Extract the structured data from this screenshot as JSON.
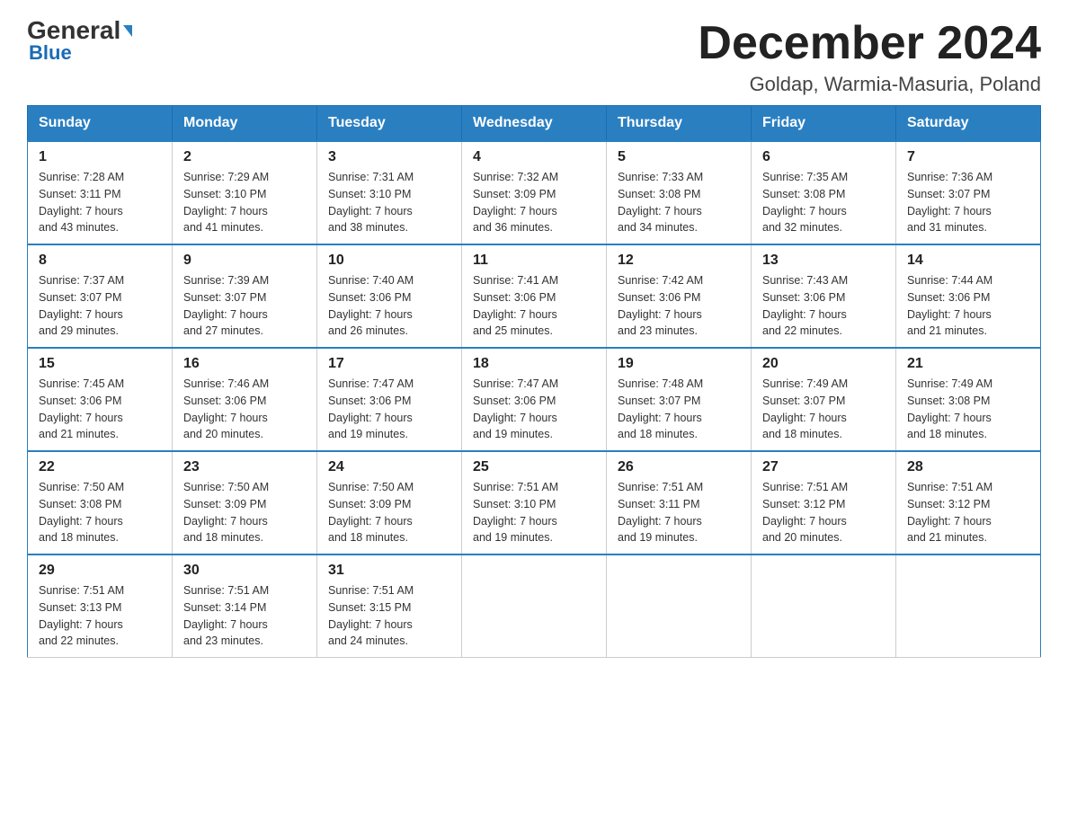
{
  "header": {
    "title": "December 2024",
    "location": "Goldap, Warmia-Masuria, Poland",
    "logo_general": "General",
    "logo_blue": "Blue"
  },
  "columns": [
    "Sunday",
    "Monday",
    "Tuesday",
    "Wednesday",
    "Thursday",
    "Friday",
    "Saturday"
  ],
  "weeks": [
    [
      {
        "day": "1",
        "sunrise": "7:28 AM",
        "sunset": "3:11 PM",
        "daylight": "7 hours and 43 minutes."
      },
      {
        "day": "2",
        "sunrise": "7:29 AM",
        "sunset": "3:10 PM",
        "daylight": "7 hours and 41 minutes."
      },
      {
        "day": "3",
        "sunrise": "7:31 AM",
        "sunset": "3:10 PM",
        "daylight": "7 hours and 38 minutes."
      },
      {
        "day": "4",
        "sunrise": "7:32 AM",
        "sunset": "3:09 PM",
        "daylight": "7 hours and 36 minutes."
      },
      {
        "day": "5",
        "sunrise": "7:33 AM",
        "sunset": "3:08 PM",
        "daylight": "7 hours and 34 minutes."
      },
      {
        "day": "6",
        "sunrise": "7:35 AM",
        "sunset": "3:08 PM",
        "daylight": "7 hours and 32 minutes."
      },
      {
        "day": "7",
        "sunrise": "7:36 AM",
        "sunset": "3:07 PM",
        "daylight": "7 hours and 31 minutes."
      }
    ],
    [
      {
        "day": "8",
        "sunrise": "7:37 AM",
        "sunset": "3:07 PM",
        "daylight": "7 hours and 29 minutes."
      },
      {
        "day": "9",
        "sunrise": "7:39 AM",
        "sunset": "3:07 PM",
        "daylight": "7 hours and 27 minutes."
      },
      {
        "day": "10",
        "sunrise": "7:40 AM",
        "sunset": "3:06 PM",
        "daylight": "7 hours and 26 minutes."
      },
      {
        "day": "11",
        "sunrise": "7:41 AM",
        "sunset": "3:06 PM",
        "daylight": "7 hours and 25 minutes."
      },
      {
        "day": "12",
        "sunrise": "7:42 AM",
        "sunset": "3:06 PM",
        "daylight": "7 hours and 23 minutes."
      },
      {
        "day": "13",
        "sunrise": "7:43 AM",
        "sunset": "3:06 PM",
        "daylight": "7 hours and 22 minutes."
      },
      {
        "day": "14",
        "sunrise": "7:44 AM",
        "sunset": "3:06 PM",
        "daylight": "7 hours and 21 minutes."
      }
    ],
    [
      {
        "day": "15",
        "sunrise": "7:45 AM",
        "sunset": "3:06 PM",
        "daylight": "7 hours and 21 minutes."
      },
      {
        "day": "16",
        "sunrise": "7:46 AM",
        "sunset": "3:06 PM",
        "daylight": "7 hours and 20 minutes."
      },
      {
        "day": "17",
        "sunrise": "7:47 AM",
        "sunset": "3:06 PM",
        "daylight": "7 hours and 19 minutes."
      },
      {
        "day": "18",
        "sunrise": "7:47 AM",
        "sunset": "3:06 PM",
        "daylight": "7 hours and 19 minutes."
      },
      {
        "day": "19",
        "sunrise": "7:48 AM",
        "sunset": "3:07 PM",
        "daylight": "7 hours and 18 minutes."
      },
      {
        "day": "20",
        "sunrise": "7:49 AM",
        "sunset": "3:07 PM",
        "daylight": "7 hours and 18 minutes."
      },
      {
        "day": "21",
        "sunrise": "7:49 AM",
        "sunset": "3:08 PM",
        "daylight": "7 hours and 18 minutes."
      }
    ],
    [
      {
        "day": "22",
        "sunrise": "7:50 AM",
        "sunset": "3:08 PM",
        "daylight": "7 hours and 18 minutes."
      },
      {
        "day": "23",
        "sunrise": "7:50 AM",
        "sunset": "3:09 PM",
        "daylight": "7 hours and 18 minutes."
      },
      {
        "day": "24",
        "sunrise": "7:50 AM",
        "sunset": "3:09 PM",
        "daylight": "7 hours and 18 minutes."
      },
      {
        "day": "25",
        "sunrise": "7:51 AM",
        "sunset": "3:10 PM",
        "daylight": "7 hours and 19 minutes."
      },
      {
        "day": "26",
        "sunrise": "7:51 AM",
        "sunset": "3:11 PM",
        "daylight": "7 hours and 19 minutes."
      },
      {
        "day": "27",
        "sunrise": "7:51 AM",
        "sunset": "3:12 PM",
        "daylight": "7 hours and 20 minutes."
      },
      {
        "day": "28",
        "sunrise": "7:51 AM",
        "sunset": "3:12 PM",
        "daylight": "7 hours and 21 minutes."
      }
    ],
    [
      {
        "day": "29",
        "sunrise": "7:51 AM",
        "sunset": "3:13 PM",
        "daylight": "7 hours and 22 minutes."
      },
      {
        "day": "30",
        "sunrise": "7:51 AM",
        "sunset": "3:14 PM",
        "daylight": "7 hours and 23 minutes."
      },
      {
        "day": "31",
        "sunrise": "7:51 AM",
        "sunset": "3:15 PM",
        "daylight": "7 hours and 24 minutes."
      },
      null,
      null,
      null,
      null
    ]
  ],
  "labels": {
    "sunrise": "Sunrise:",
    "sunset": "Sunset:",
    "daylight": "Daylight:"
  }
}
